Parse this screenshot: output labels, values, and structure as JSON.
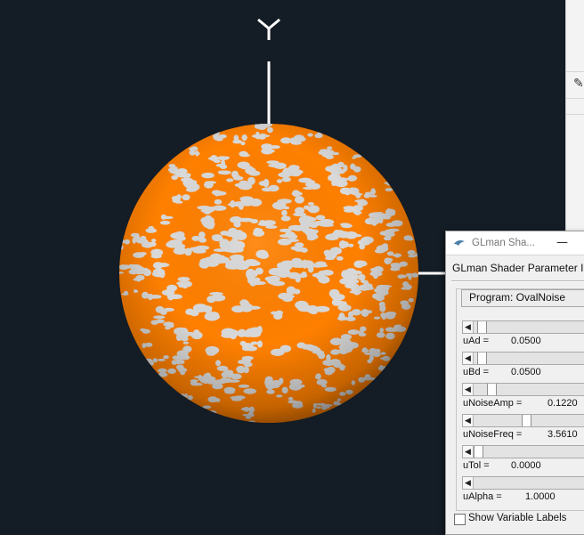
{
  "window": {
    "title": "GLman Sha...",
    "minimize_symbol": "—",
    "header": "GLman Shader Parameter I",
    "program_label": "Program: OvalNoise",
    "show_labels_text": "Show Variable Labels",
    "show_labels_checked": false
  },
  "params": [
    {
      "name": "uAd =",
      "value": "0.0500",
      "slider_fraction": 0.03
    },
    {
      "name": "uBd =",
      "value": "0.0500",
      "slider_fraction": 0.03
    },
    {
      "name": "uNoiseAmp =",
      "value": "0.1220",
      "slider_fraction": 0.12
    },
    {
      "name": "uNoiseFreq =",
      "value": "3.5610",
      "slider_fraction": 0.42
    },
    {
      "name": "uTol =",
      "value": "0.0000",
      "slider_fraction": 0.0
    },
    {
      "name": "uAlpha =",
      "value": "1.0000",
      "slider_fraction": 1.0
    }
  ],
  "scene": {
    "background": "#141c25",
    "sphere_color": "#ff8000",
    "spot_color": "#d9d9d9",
    "axis_color": "#ffffff",
    "axis_label": "Y"
  },
  "icons": [
    "glman-app-icon",
    "minimize-icon",
    "pen-icon",
    "slider-left-arrow-icon",
    "checkbox-icon"
  ]
}
